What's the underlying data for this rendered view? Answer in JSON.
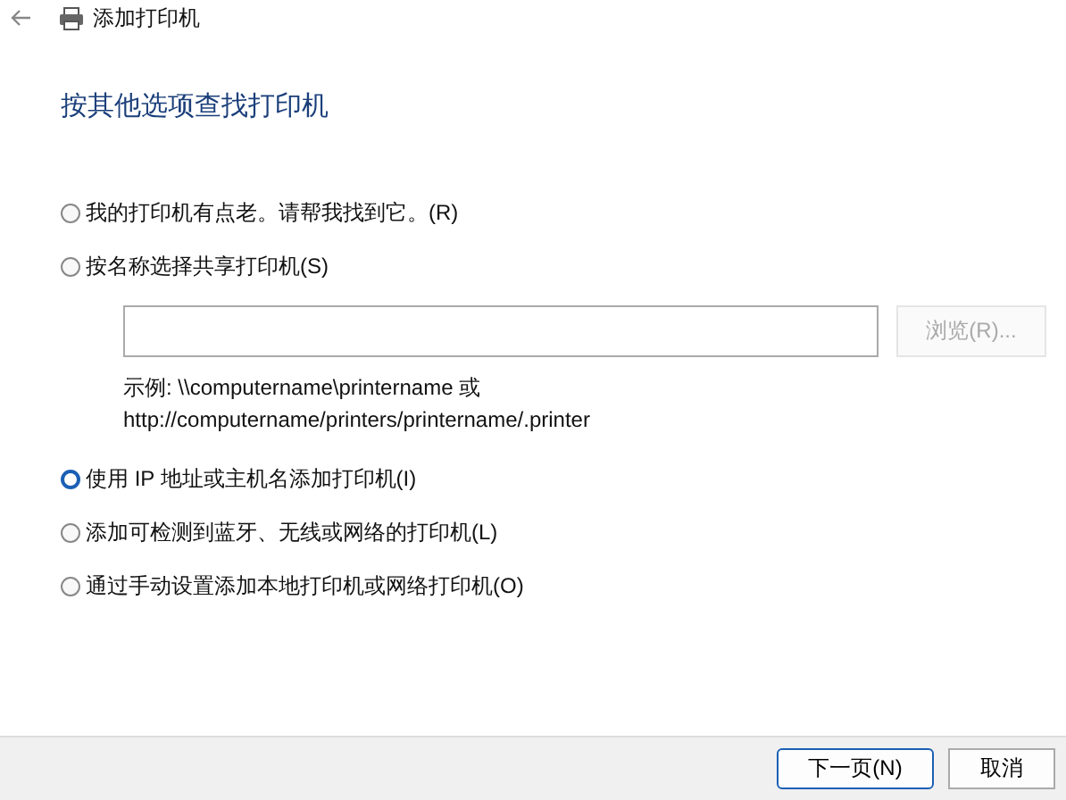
{
  "window": {
    "title": "添加打印机"
  },
  "heading": "按其他选项查找打印机",
  "options": [
    {
      "label": "我的打印机有点老。请帮我找到它。(R)",
      "selected": false
    },
    {
      "label": "按名称选择共享打印机(S)",
      "selected": false,
      "kind": "share"
    },
    {
      "label": "使用 IP 地址或主机名添加打印机(I)",
      "selected": true
    },
    {
      "label": "添加可检测到蓝牙、无线或网络的打印机(L)",
      "selected": false
    },
    {
      "label": "通过手动设置添加本地打印机或网络打印机(O)",
      "selected": false
    }
  ],
  "share": {
    "browse": {
      "label": "浏览(R)...",
      "disabled": true
    },
    "example_lines": [
      "示例: \\\\computername\\printername 或",
      "http://computername/printers/printername/.printer"
    ]
  },
  "buttons": [
    {
      "label": "下一页(N)",
      "primary": true
    },
    {
      "label": "取消",
      "primary": false
    }
  ]
}
